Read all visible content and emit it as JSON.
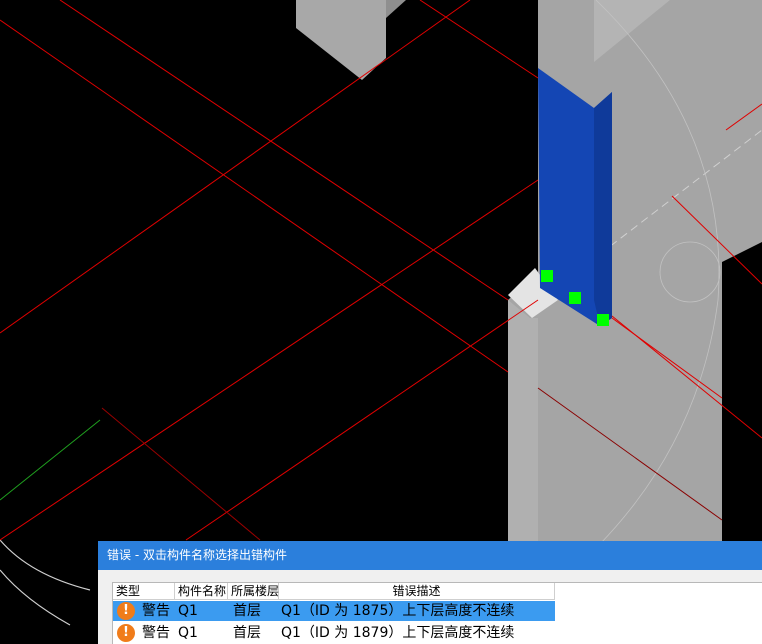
{
  "panel": {
    "title": "错误 - 双击构件名称选择出错构件",
    "columns": [
      "类型",
      "构件名称",
      "所属楼层",
      "错误描述"
    ],
    "rows": [
      {
        "type": "警告",
        "name": "Q1",
        "floor": "首层",
        "desc": "Q1（ID 为 1875）上下层高度不连续",
        "selected": true,
        "icon": "warning-icon"
      },
      {
        "type": "警告",
        "name": "Q1",
        "floor": "首层",
        "desc": "Q1（ID 为 1879）上下层高度不连续",
        "selected": false,
        "icon": "warning-icon"
      }
    ]
  },
  "colors": {
    "selected_wall": "#1446b4",
    "grip": "#00ff00",
    "axis_line": "#e00000",
    "wall": "#a5a5a5",
    "title_bar": "#2b7fdc",
    "selected_row": "#3b9bf0",
    "warning": "#f07c1a"
  }
}
